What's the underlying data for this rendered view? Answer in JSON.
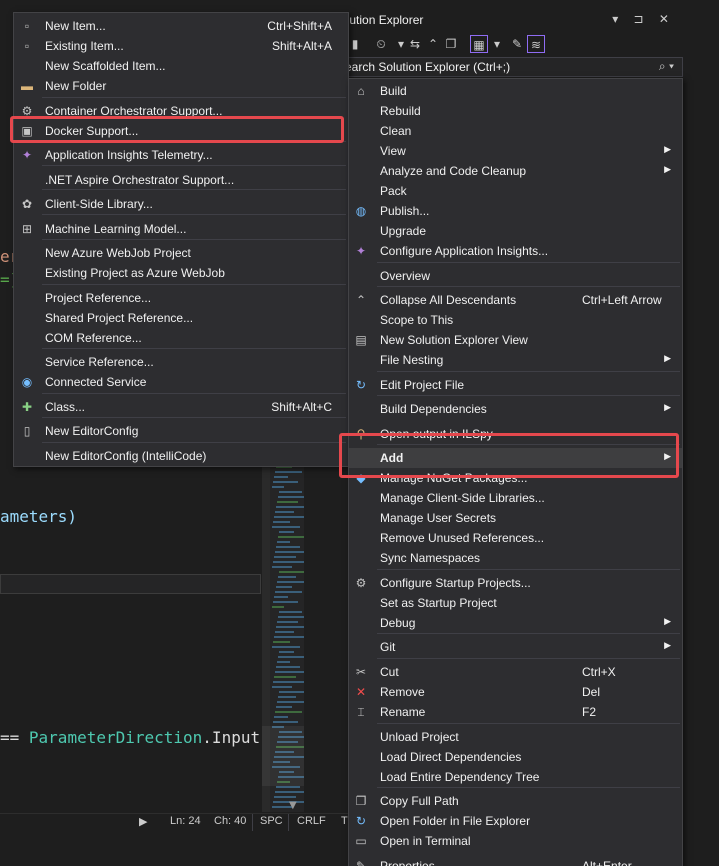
{
  "editor": {
    "line_a": "ameters)",
    "line_b_op": "== ",
    "line_b_type": "ParameterDirection",
    "line_b_prop": ".Input",
    "line_e": "er",
    "line_f": "=]"
  },
  "statusbar": {
    "arrow": "▶",
    "ln": "Ln: 24",
    "ch": "Ch: 40",
    "spc": "SPC",
    "crlf": "CRLF",
    "tail": "T"
  },
  "solution_explorer": {
    "title": "olution Explorer",
    "header_buttons": "▾ ⊐ ✕",
    "search_placeholder": "earch Solution Explorer (Ctrl+;)",
    "search_icon": "⌕ ▾"
  },
  "add_menu": {
    "items": [
      {
        "label": "New Item...",
        "shortcut": "Ctrl+Shift+A",
        "icon": "new-item-icon",
        "glyph": "▫"
      },
      {
        "label": "Existing Item...",
        "shortcut": "Shift+Alt+A",
        "icon": "existing-item-icon",
        "glyph": "▫"
      },
      {
        "label": "New Scaffolded Item...",
        "shortcut": "",
        "icon": "",
        "glyph": ""
      },
      {
        "label": "New Folder",
        "shortcut": "",
        "icon": "folder-icon",
        "glyph": "▬"
      },
      {
        "label": "Container Orchestrator Support...",
        "shortcut": "",
        "icon": "container-icon",
        "glyph": "⚙"
      },
      {
        "label": "Docker Support...",
        "shortcut": "",
        "icon": "docker-icon",
        "glyph": "▣"
      },
      {
        "label": "Application Insights Telemetry...",
        "shortcut": "",
        "icon": "insights-icon",
        "glyph": "✦"
      },
      {
        "label": ".NET Aspire Orchestrator Support...",
        "shortcut": "",
        "icon": "",
        "glyph": ""
      },
      {
        "label": "Client-Side Library...",
        "shortcut": "",
        "icon": "library-icon",
        "glyph": "✿"
      },
      {
        "label": "Machine Learning Model...",
        "shortcut": "",
        "icon": "ml-model-icon",
        "glyph": "⊞"
      },
      {
        "label": "New Azure WebJob Project",
        "shortcut": "",
        "icon": "",
        "glyph": ""
      },
      {
        "label": "Existing Project as Azure WebJob",
        "shortcut": "",
        "icon": "",
        "glyph": ""
      },
      {
        "label": "Project Reference...",
        "shortcut": "",
        "icon": "",
        "glyph": ""
      },
      {
        "label": "Shared Project Reference...",
        "shortcut": "",
        "icon": "",
        "glyph": ""
      },
      {
        "label": "COM Reference...",
        "shortcut": "",
        "icon": "",
        "glyph": ""
      },
      {
        "label": "Service Reference...",
        "shortcut": "",
        "icon": "",
        "glyph": ""
      },
      {
        "label": "Connected Service",
        "shortcut": "",
        "icon": "connected-service-icon",
        "glyph": "◉"
      },
      {
        "label": "Class...",
        "shortcut": "Shift+Alt+C",
        "icon": "class-icon",
        "glyph": "✚"
      },
      {
        "label": "New EditorConfig",
        "shortcut": "",
        "icon": "file-icon",
        "glyph": "▯"
      },
      {
        "label": "New EditorConfig (IntelliCode)",
        "shortcut": "",
        "icon": "",
        "glyph": ""
      }
    ]
  },
  "context_menu": {
    "items": [
      {
        "label": "Build",
        "shortcut": "",
        "submenu": false,
        "icon": "build-icon",
        "glyph": "⌂"
      },
      {
        "label": "Rebuild",
        "shortcut": "",
        "submenu": false,
        "icon": "",
        "glyph": ""
      },
      {
        "label": "Clean",
        "shortcut": "",
        "submenu": false,
        "icon": "",
        "glyph": ""
      },
      {
        "label": "View",
        "shortcut": "",
        "submenu": true,
        "icon": "",
        "glyph": ""
      },
      {
        "label": "Analyze and Code Cleanup",
        "shortcut": "",
        "submenu": true,
        "icon": "",
        "glyph": ""
      },
      {
        "label": "Pack",
        "shortcut": "",
        "submenu": false,
        "icon": "",
        "glyph": ""
      },
      {
        "label": "Publish...",
        "shortcut": "",
        "submenu": false,
        "icon": "globe-icon",
        "glyph": "◍"
      },
      {
        "label": "Upgrade",
        "shortcut": "",
        "submenu": false,
        "icon": "",
        "glyph": ""
      },
      {
        "label": "Configure Application Insights...",
        "shortcut": "",
        "submenu": false,
        "icon": "insights-icon",
        "glyph": "✦"
      },
      {
        "label": "Overview",
        "shortcut": "",
        "submenu": false,
        "icon": "",
        "glyph": ""
      },
      {
        "label": "Collapse All Descendants",
        "shortcut": "Ctrl+Left Arrow",
        "submenu": false,
        "icon": "collapse-icon",
        "glyph": "⌃"
      },
      {
        "label": "Scope to This",
        "shortcut": "",
        "submenu": false,
        "icon": "",
        "glyph": ""
      },
      {
        "label": "New Solution Explorer View",
        "shortcut": "",
        "submenu": false,
        "icon": "new-view-icon",
        "glyph": "▤"
      },
      {
        "label": "File Nesting",
        "shortcut": "",
        "submenu": true,
        "icon": "",
        "glyph": ""
      },
      {
        "label": "Edit Project File",
        "shortcut": "",
        "submenu": false,
        "icon": "edit-icon",
        "glyph": "↻"
      },
      {
        "label": "Build Dependencies",
        "shortcut": "",
        "submenu": true,
        "icon": "",
        "glyph": ""
      },
      {
        "label": "Open output in ILSpy",
        "shortcut": "",
        "submenu": false,
        "icon": "ilspy-icon",
        "glyph": "⚲"
      },
      {
        "label": "Add",
        "shortcut": "",
        "submenu": true,
        "icon": "",
        "glyph": ""
      },
      {
        "label": "Manage NuGet Packages...",
        "shortcut": "",
        "submenu": false,
        "icon": "nuget-icon",
        "glyph": "◆"
      },
      {
        "label": "Manage Client-Side Libraries...",
        "shortcut": "",
        "submenu": false,
        "icon": "",
        "glyph": ""
      },
      {
        "label": "Manage User Secrets",
        "shortcut": "",
        "submenu": false,
        "icon": "",
        "glyph": ""
      },
      {
        "label": "Remove Unused References...",
        "shortcut": "",
        "submenu": false,
        "icon": "",
        "glyph": ""
      },
      {
        "label": "Sync Namespaces",
        "shortcut": "",
        "submenu": false,
        "icon": "",
        "glyph": ""
      },
      {
        "label": "Configure Startup Projects...",
        "shortcut": "",
        "submenu": false,
        "icon": "settings-icon",
        "glyph": "⚙"
      },
      {
        "label": "Set as Startup Project",
        "shortcut": "",
        "submenu": false,
        "icon": "",
        "glyph": ""
      },
      {
        "label": "Debug",
        "shortcut": "",
        "submenu": true,
        "icon": "",
        "glyph": ""
      },
      {
        "label": "Git",
        "shortcut": "",
        "submenu": true,
        "icon": "",
        "glyph": ""
      },
      {
        "label": "Cut",
        "shortcut": "Ctrl+X",
        "submenu": false,
        "icon": "cut-icon",
        "glyph": "✂"
      },
      {
        "label": "Remove",
        "shortcut": "Del",
        "submenu": false,
        "icon": "remove-icon",
        "glyph": "✕"
      },
      {
        "label": "Rename",
        "shortcut": "F2",
        "submenu": false,
        "icon": "rename-icon",
        "glyph": "⌶"
      },
      {
        "label": "Unload Project",
        "shortcut": "",
        "submenu": false,
        "icon": "",
        "glyph": ""
      },
      {
        "label": "Load Direct Dependencies",
        "shortcut": "",
        "submenu": false,
        "icon": "",
        "glyph": ""
      },
      {
        "label": "Load Entire Dependency Tree",
        "shortcut": "",
        "submenu": false,
        "icon": "",
        "glyph": ""
      },
      {
        "label": "Copy Full Path",
        "shortcut": "",
        "submenu": false,
        "icon": "copy-icon",
        "glyph": "❐"
      },
      {
        "label": "Open Folder in File Explorer",
        "shortcut": "",
        "submenu": false,
        "icon": "open-folder-icon",
        "glyph": "↻"
      },
      {
        "label": "Open in Terminal",
        "shortcut": "",
        "submenu": false,
        "icon": "terminal-icon",
        "glyph": "▭"
      },
      {
        "label": "Properties",
        "shortcut": "Alt+Enter",
        "submenu": false,
        "icon": "wrench-icon",
        "glyph": "✎"
      }
    ]
  },
  "colors": {
    "highlight": "#e5484d",
    "menu_bg": "#2d2d30",
    "accent": "#8f6cf3"
  }
}
